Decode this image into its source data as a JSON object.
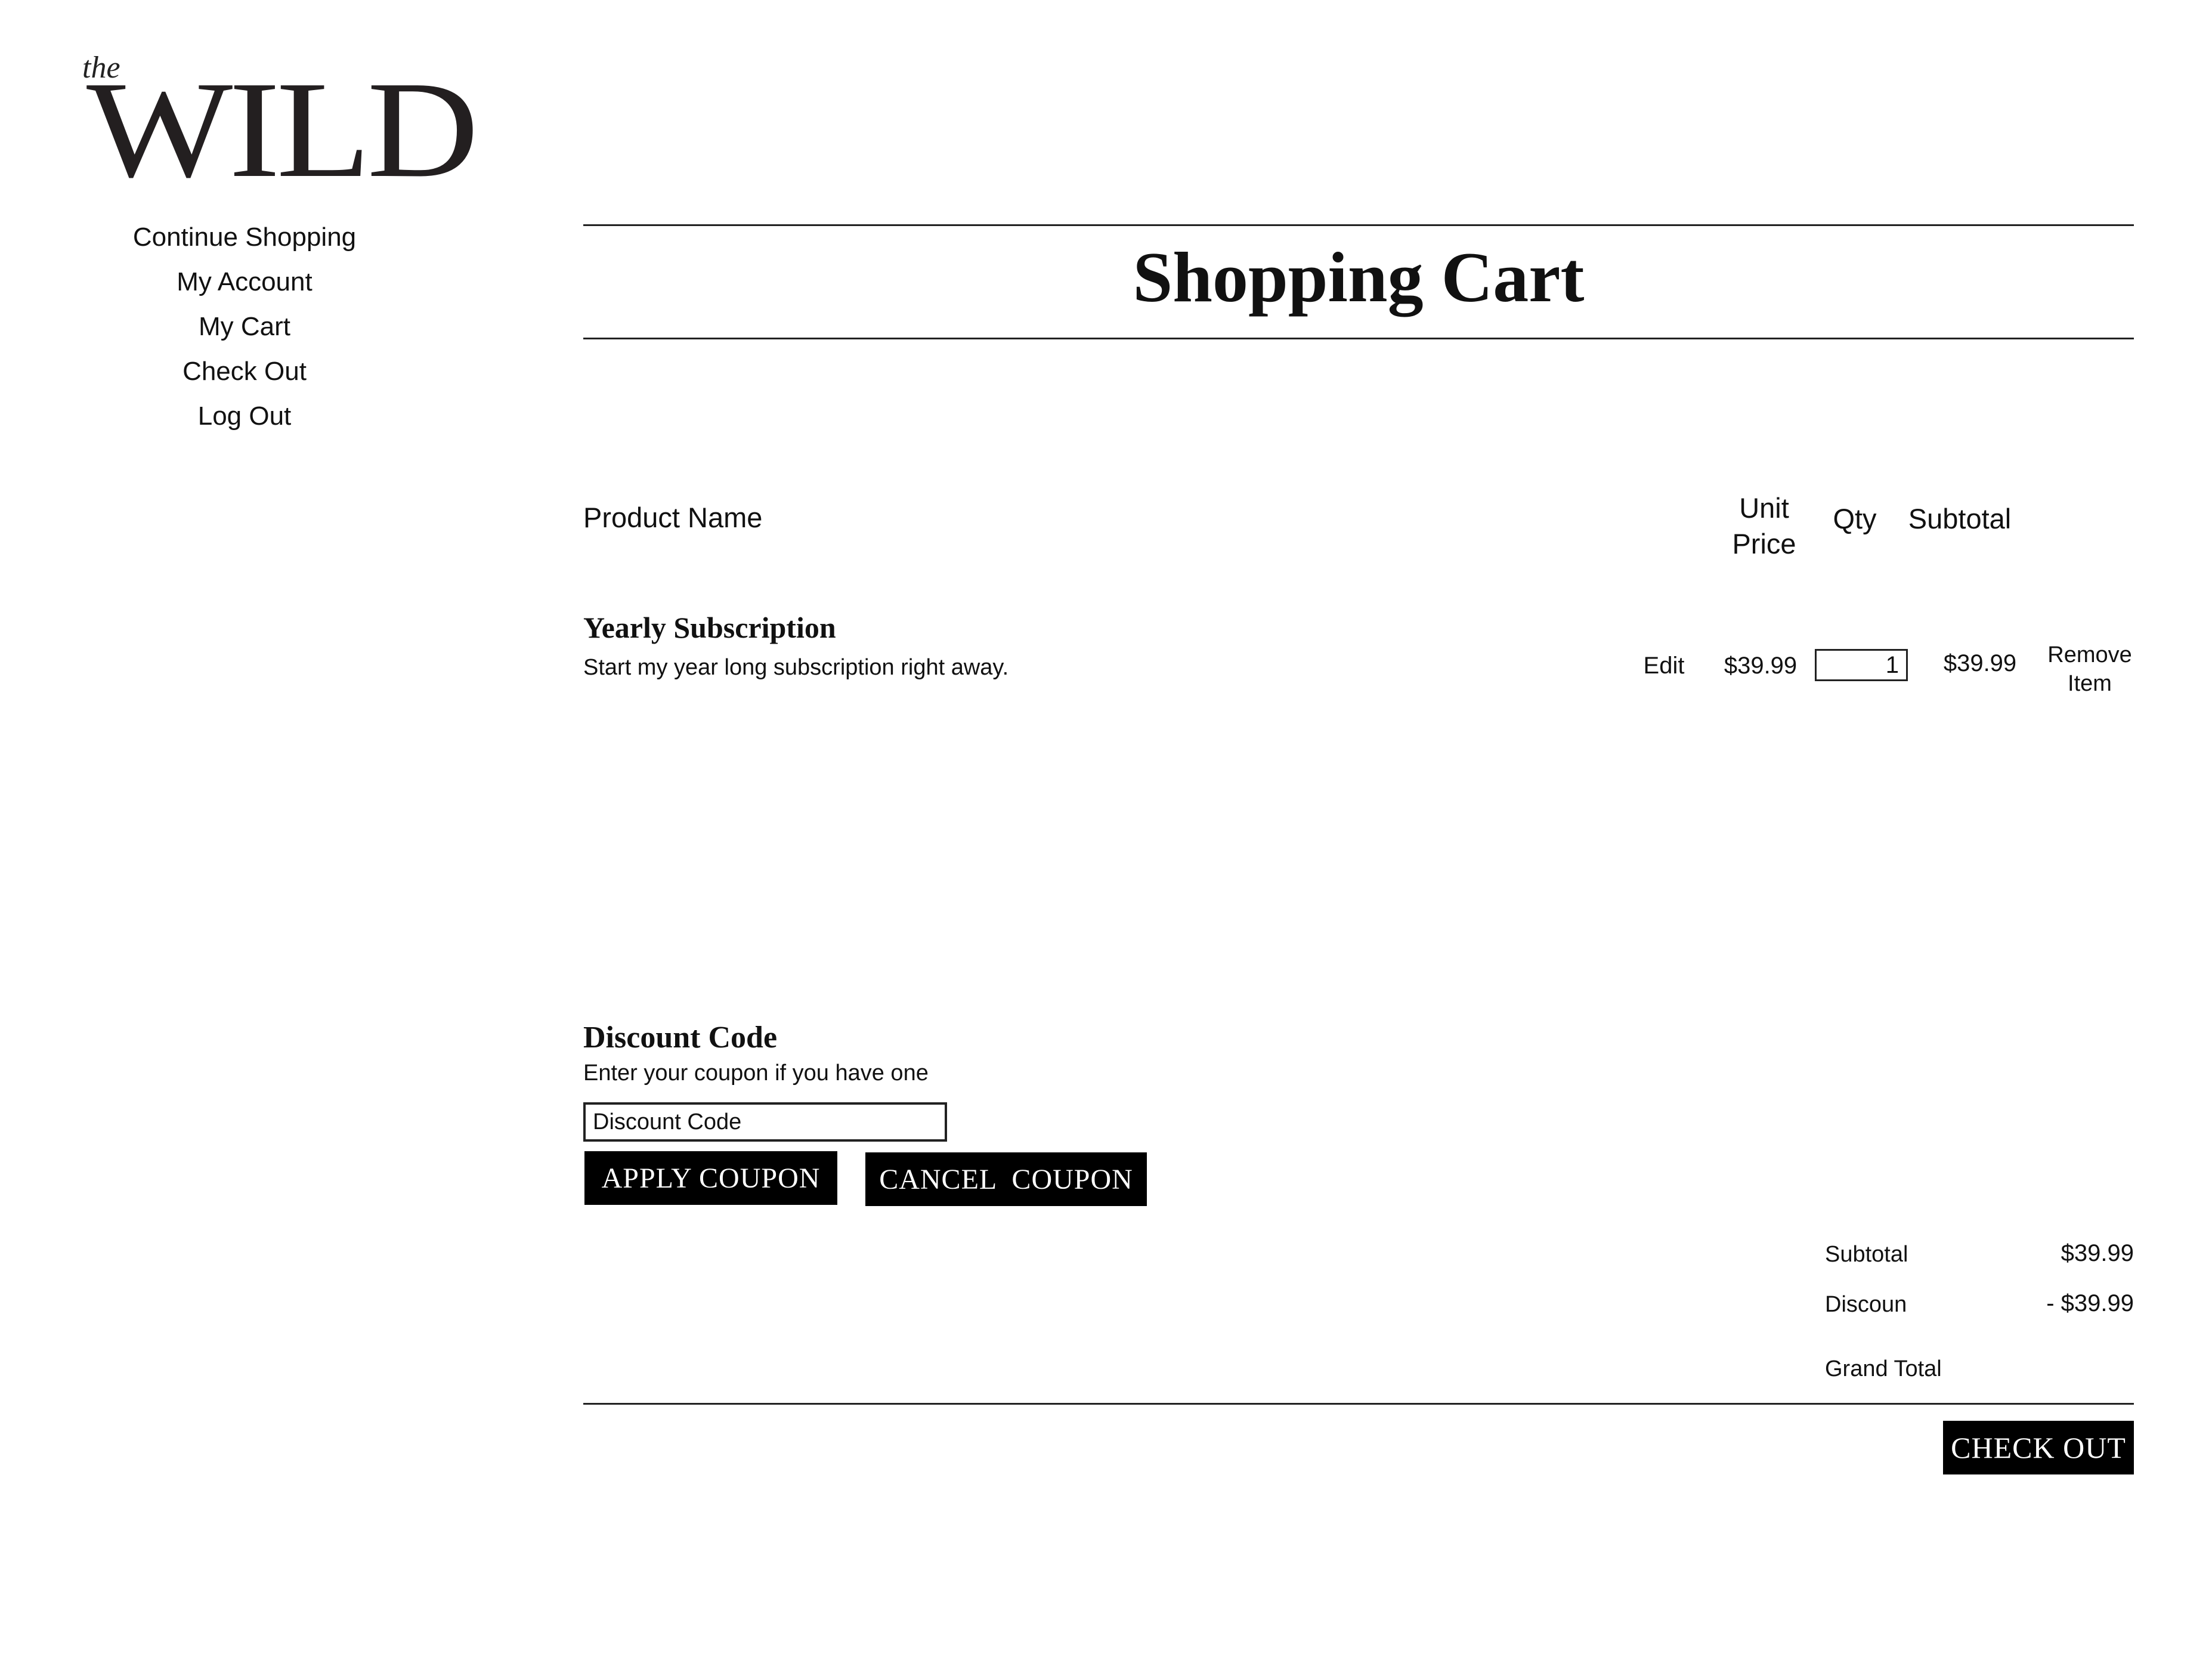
{
  "logo": {
    "prefix": "the",
    "name": "WILD"
  },
  "nav": {
    "items": [
      {
        "label": "Continue Shopping"
      },
      {
        "label": "My Account"
      },
      {
        "label": "My Cart"
      },
      {
        "label": "Check Out"
      },
      {
        "label": "Log Out"
      }
    ]
  },
  "page_title": "Shopping Cart",
  "table": {
    "headers": {
      "product_name": "Product Name",
      "unit_price_line1": "Unit",
      "unit_price_line2": "Price",
      "qty": "Qty",
      "subtotal": "Subtotal"
    },
    "rows": [
      {
        "name": "Yearly Subscription",
        "description": "Start my year long subscription right away.",
        "edit_label": "Edit",
        "unit_price": "$39.99",
        "qty": "1",
        "subtotal": "$39.99",
        "remove_line1": "Remove",
        "remove_line2": "Item"
      }
    ]
  },
  "discount": {
    "title": "Discount Code",
    "subtitle": "Enter your coupon if you have one",
    "input_value": "",
    "placeholder": "Discount Code",
    "apply_label": "APPLY COUPON",
    "cancel_label": "CANCEL  COUPON"
  },
  "totals": {
    "subtotal_label": "Subtotal",
    "subtotal_value": "$39.99",
    "discount_label": "Discoun",
    "discount_value": "- $39.99",
    "grand_total_label": "Grand Total",
    "grand_total_value": ""
  },
  "checkout_label": "CHECK OUT",
  "colors": {
    "text": "#111111",
    "button_bg": "#000000",
    "button_text": "#ffffff",
    "rule": "#222222"
  }
}
